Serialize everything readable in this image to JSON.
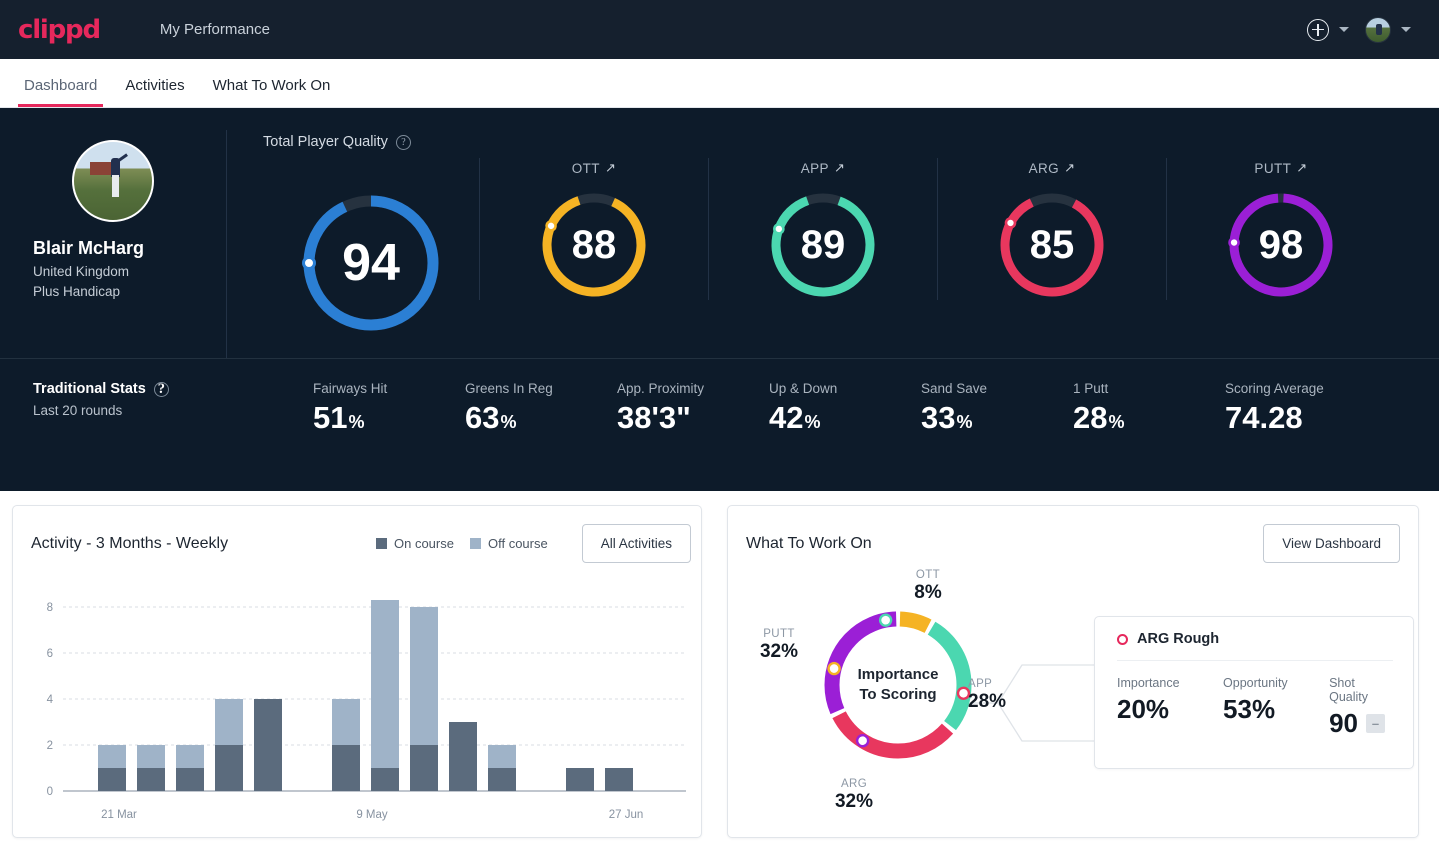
{
  "topbar": {
    "logo": "clippd",
    "title": "My Performance",
    "add_icon": "plus-circle-icon",
    "chevron_icon": "chevron-down-icon"
  },
  "tabs": [
    {
      "label": "Dashboard",
      "active": true
    },
    {
      "label": "Activities",
      "active": false
    },
    {
      "label": "What To Work On",
      "active": false
    }
  ],
  "player": {
    "name": "Blair McHarg",
    "country": "United Kingdom",
    "handicap": "Plus Handicap"
  },
  "tpq": {
    "label": "Total Player Quality",
    "help_icon": "question-mark-icon",
    "gauges": [
      {
        "title": "",
        "value": "94",
        "pct": 93,
        "color": "#2b7fd4",
        "trend": ""
      },
      {
        "title": "OTT",
        "value": "88",
        "pct": 88,
        "color": "#f5b324",
        "trend": "↗"
      },
      {
        "title": "APP",
        "value": "89",
        "pct": 89,
        "color": "#4bd7b0",
        "trend": "↗"
      },
      {
        "title": "ARG",
        "value": "85",
        "pct": 85,
        "color": "#e8375e",
        "trend": "↗"
      },
      {
        "title": "PUTT",
        "value": "98",
        "pct": 98,
        "color": "#9b1fd6",
        "trend": "↗"
      }
    ]
  },
  "traditional": {
    "title": "Traditional Stats",
    "help_icon": "question-mark-icon",
    "subtitle": "Last 20 rounds",
    "stats": [
      {
        "label": "Fairways Hit",
        "value": "51",
        "unit": "%"
      },
      {
        "label": "Greens In Reg",
        "value": "63",
        "unit": "%"
      },
      {
        "label": "App. Proximity",
        "value": "38'3\"",
        "unit": ""
      },
      {
        "label": "Up & Down",
        "value": "42",
        "unit": "%"
      },
      {
        "label": "Sand Save",
        "value": "33",
        "unit": "%"
      },
      {
        "label": "1 Putt",
        "value": "28",
        "unit": "%"
      },
      {
        "label": "Scoring Average",
        "value": "74.28",
        "unit": ""
      }
    ]
  },
  "activity": {
    "title": "Activity - 3 Months - Weekly",
    "legend": [
      {
        "label": "On course",
        "color": "#5b6b7d"
      },
      {
        "label": "Off course",
        "color": "#9fb3c8"
      }
    ],
    "button": "All Activities"
  },
  "wtwo": {
    "title": "What To Work On",
    "button": "View Dashboard",
    "center_line1": "Importance",
    "center_line2": "To Scoring",
    "detail": {
      "marker_icon": "ring-dot-icon",
      "title": "ARG Rough",
      "stats": [
        {
          "label": "Importance",
          "value": "20%"
        },
        {
          "label": "Opportunity",
          "value": "53%"
        },
        {
          "label": "Shot Quality",
          "value": "90",
          "badge": "–"
        }
      ]
    }
  },
  "chart_data": [
    {
      "type": "bar",
      "title": "Activity - 3 Months - Weekly",
      "xlabel": "",
      "ylabel": "",
      "ylim": [
        0,
        9
      ],
      "yticks": [
        0,
        2,
        4,
        6,
        8
      ],
      "grid": true,
      "legend_position": "top-right",
      "categories": [
        "w1",
        "w2",
        "w3",
        "w4",
        "w5",
        "w6",
        "w7",
        "w8",
        "w9",
        "w10",
        "w11",
        "w12",
        "w13",
        "w14",
        "w15"
      ],
      "xtick_labels": [
        "21 Mar",
        "9 May",
        "27 Jun"
      ],
      "xtick_positions": [
        1,
        7,
        13
      ],
      "stacked": true,
      "series": [
        {
          "name": "On course",
          "color": "#5b6b7d",
          "values": [
            0,
            1,
            1,
            1,
            2,
            4,
            0,
            2,
            1,
            2,
            3,
            1,
            0,
            1,
            1
          ]
        },
        {
          "name": "Off course",
          "color": "#9fb3c8",
          "values": [
            0,
            1,
            1,
            1,
            2,
            0,
            0,
            2,
            8,
            6,
            0,
            1,
            0,
            0,
            0
          ]
        }
      ]
    },
    {
      "type": "pie",
      "title": "Importance To Scoring",
      "labels": [
        "OTT",
        "APP",
        "ARG",
        "PUTT"
      ],
      "values": [
        8,
        28,
        32,
        32
      ],
      "value_labels": [
        "8%",
        "28%",
        "32%",
        "32%"
      ],
      "colors": [
        "#f5b324",
        "#4bd7b0",
        "#e8375e",
        "#9b1fd6"
      ],
      "legend_position": "around"
    }
  ]
}
